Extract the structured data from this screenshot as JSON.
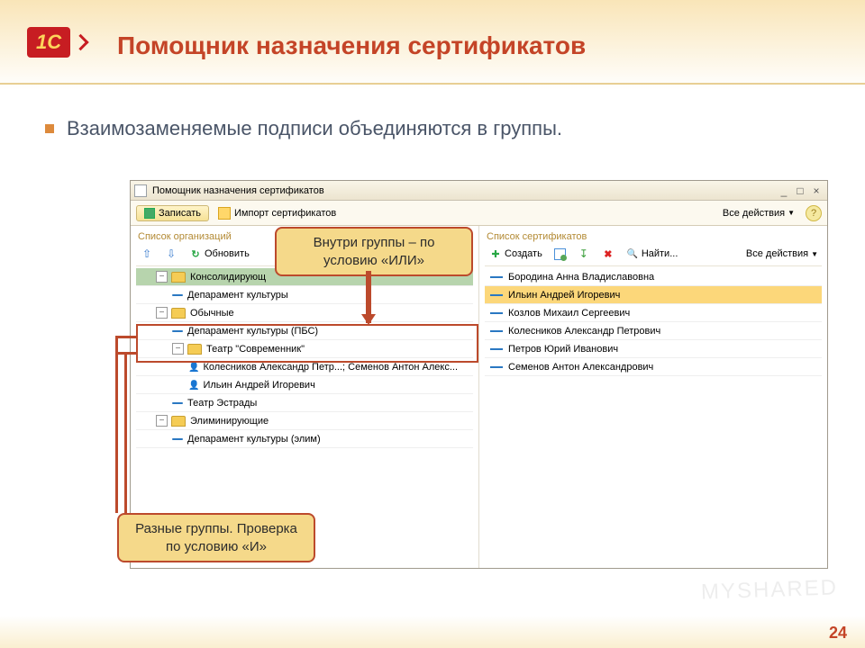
{
  "slide": {
    "title": "Помощник назначения сертификатов",
    "bullet": "Взаимозаменяемые подписи объединяются в группы.",
    "pagenum": "24",
    "logo_text": "1С"
  },
  "window": {
    "title": "Помощник назначения сертификатов",
    "toolbar": {
      "save": "Записать",
      "import": "Импорт сертификатов",
      "all_actions": "Все действия"
    }
  },
  "left_pane": {
    "title": "Список организаций",
    "toolbar": {
      "refresh": "Обновить"
    },
    "rows": [
      {
        "type": "group",
        "level": 0,
        "label": "Консолидирующ",
        "expanded": true,
        "selected": true
      },
      {
        "type": "item",
        "level": 1,
        "label": "Депарамент культуры"
      },
      {
        "type": "group",
        "level": 0,
        "label": "Обычные",
        "expanded": true
      },
      {
        "type": "item",
        "level": 1,
        "label": "Депарамент культуры (ПБС)"
      },
      {
        "type": "group",
        "level": 1,
        "label": "Театр \"Современник\"",
        "expanded": true
      },
      {
        "type": "person",
        "level": 2,
        "label": "Колесников Александр Петр...; Семенов Антон Алекс..."
      },
      {
        "type": "person",
        "level": 2,
        "label": "Ильин Андрей Игоревич"
      },
      {
        "type": "item",
        "level": 1,
        "label": "Театр Эстрады"
      },
      {
        "type": "group",
        "level": 0,
        "label": "Элиминирующие",
        "expanded": true
      },
      {
        "type": "item",
        "level": 1,
        "label": "Депарамент культуры (элим)"
      }
    ]
  },
  "right_pane": {
    "title": "Список сертификатов",
    "toolbar": {
      "create": "Создать",
      "find": "Найти...",
      "all_actions": "Все действия"
    },
    "rows": [
      {
        "label": "Бородина Анна Владиславовна"
      },
      {
        "label": "Ильин Андрей Игоревич",
        "selected": true
      },
      {
        "label": "Козлов Михаил Сергеевич"
      },
      {
        "label": "Колесников Александр Петрович"
      },
      {
        "label": "Петров Юрий Иванович"
      },
      {
        "label": "Семенов Антон Александрович"
      }
    ]
  },
  "callouts": {
    "top": "Внутри группы – по условию «ИЛИ»",
    "bottom": "Разные группы. Проверка по условию «И»"
  },
  "watermark": "MYSHARED"
}
